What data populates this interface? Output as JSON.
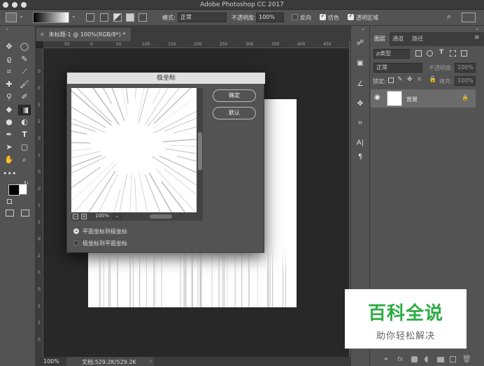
{
  "app_title": "Adobe Photoshop CC 2017",
  "options_bar": {
    "mode_label": "模式:",
    "mode_value": "正常",
    "opacity_label": "不透明度:",
    "opacity_value": "100%",
    "reverse_label": "反向",
    "dither_label": "仿色",
    "transparency_label": "透明区域",
    "dither_checked": true,
    "transparency_checked": true
  },
  "document_tab": {
    "label": "未标题-1 @ 100%(RGB/8*) *"
  },
  "ruler_top": [
    "50",
    "0",
    "50",
    "100",
    "150",
    "200",
    "250",
    "300",
    "350",
    "400",
    "450"
  ],
  "ruler_left": [
    "0",
    "0",
    "5",
    "5",
    "0",
    "1",
    "0",
    "0",
    "1",
    "5",
    "0",
    "2",
    "0",
    "0",
    "2",
    "5",
    "0"
  ],
  "dialog": {
    "title": "极坐标",
    "ok_label": "确定",
    "default_label": "默认",
    "zoom_value": "100%",
    "option1_label": "平面坐标到极坐标",
    "option2_label": "极坐标到平面坐标",
    "selected_option": 1
  },
  "status": {
    "zoom": "100%",
    "doc_info": "文档:529.2K/529.2K"
  },
  "panel": {
    "tabs": [
      "图层",
      "通道",
      "路径"
    ],
    "kind_label": "ρ类型",
    "blend_value": "正常",
    "opacity_label": "不透明度:",
    "opacity_value": "100%",
    "lock_label": "锁定:",
    "fill_label": "填充:",
    "fill_value": "100%",
    "layer_name": "背景"
  },
  "watermark": {
    "line1": "百科全说",
    "line2": "助你轻松解决"
  },
  "colors": {
    "chrome": "#535353",
    "canvas_bg": "#282828",
    "watermark_green": "#2cac44"
  }
}
